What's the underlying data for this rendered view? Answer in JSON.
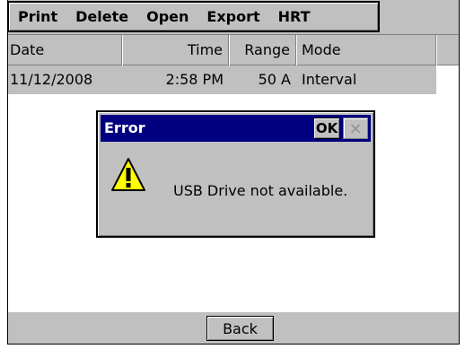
{
  "toolbar": {
    "items": [
      "Print",
      "Delete",
      "Open",
      "Export",
      "HRT"
    ]
  },
  "table": {
    "columns": [
      "Date",
      "Time",
      "Range",
      "Mode"
    ],
    "rows": [
      [
        "11/12/2008",
        "2:58 PM",
        "50 A",
        "Interval"
      ]
    ]
  },
  "dialog": {
    "title": "Error",
    "ok_label": "OK",
    "close_glyph": "×",
    "message": "USB Drive not available.",
    "icon": "warning-icon"
  },
  "footer": {
    "back_label": "Back"
  },
  "colors": {
    "titlebar": "#000080",
    "chrome": "#c0c0c0",
    "warning": "#ffff00"
  }
}
